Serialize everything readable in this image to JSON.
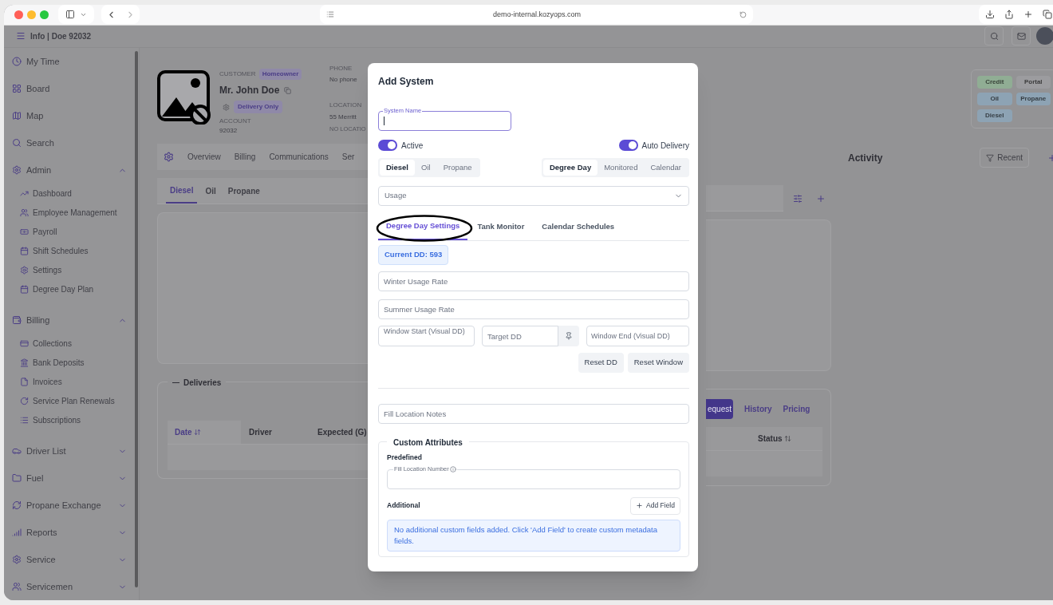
{
  "browser": {
    "url": "demo-internal.kozyops.com"
  },
  "header": {
    "title": "Info | Doe 92032"
  },
  "sidebar": {
    "items": [
      {
        "label": "My Time"
      },
      {
        "label": "Board"
      },
      {
        "label": "Map"
      },
      {
        "label": "Search"
      },
      {
        "label": "Admin",
        "expanded": true,
        "children": [
          {
            "label": "Dashboard"
          },
          {
            "label": "Employee Management"
          },
          {
            "label": "Payroll"
          },
          {
            "label": "Shift Schedules"
          },
          {
            "label": "Settings"
          },
          {
            "label": "Degree Day Plan"
          }
        ]
      },
      {
        "label": "Billing",
        "expanded": true,
        "children": [
          {
            "label": "Collections"
          },
          {
            "label": "Bank Deposits"
          },
          {
            "label": "Invoices"
          },
          {
            "label": "Service Plan Renewals"
          },
          {
            "label": "Subscriptions"
          }
        ]
      },
      {
        "label": "Driver List",
        "expanded": false
      },
      {
        "label": "Fuel",
        "expanded": false
      },
      {
        "label": "Propane Exchange",
        "expanded": false
      },
      {
        "label": "Reports",
        "expanded": false
      },
      {
        "label": "Service",
        "expanded": false
      },
      {
        "label": "Servicemen",
        "expanded": false
      }
    ]
  },
  "customer": {
    "type_label": "CUSTOMER",
    "type_badge": "Homeowner",
    "name": "Mr. John Doe",
    "delivery_badge": "Delivery Only",
    "account_label": "ACCOUNT",
    "account": "92032",
    "phone_label": "PHONE",
    "phone": "No phone",
    "location_label": "LOCATION",
    "location": "55 Merritt",
    "location_note": "NO LOCATIO"
  },
  "tags": [
    {
      "label": "Credit",
      "color": "#90ad94"
    },
    {
      "label": "Portal",
      "color": "#9c9c9f"
    },
    {
      "label": "Oil",
      "color": "#8da3b4"
    },
    {
      "label": "Propane",
      "color": "#8da3b4"
    },
    {
      "label": "Diesel",
      "color": "#8da3b4"
    }
  ],
  "tabs": [
    {
      "label": "Overview",
      "selected": false
    },
    {
      "label": "Billing",
      "selected": false
    },
    {
      "label": "Communications",
      "selected": false
    },
    {
      "label": "Ser",
      "selected": false
    }
  ],
  "fuel_tabs": [
    {
      "label": "Diesel",
      "selected": true
    },
    {
      "label": "Oil",
      "selected": false
    },
    {
      "label": "Propane",
      "selected": false
    }
  ],
  "deliveries": {
    "title": "Deliveries",
    "buttons": [
      {
        "label": "equest",
        "selected": true
      },
      {
        "label": "History",
        "selected": false
      },
      {
        "label": "Pricing",
        "selected": false
      }
    ],
    "columns": [
      "Date",
      "Driver",
      "Expected (G)",
      "Status"
    ]
  },
  "activity": {
    "title": "Activity",
    "filter": "Recent"
  },
  "modal": {
    "title": "Add System",
    "system_name_label": "System Name",
    "toggles": [
      {
        "label": "Active",
        "on": true
      },
      {
        "label": "Auto Delivery",
        "on": true
      }
    ],
    "fuel_segments": [
      {
        "label": "Diesel",
        "selected": true
      },
      {
        "label": "Oil",
        "selected": false
      },
      {
        "label": "Propane",
        "selected": false
      }
    ],
    "mode_segments": [
      {
        "label": "Degree Day",
        "selected": true
      },
      {
        "label": "Monitored",
        "selected": false
      },
      {
        "label": "Calendar",
        "selected": false
      }
    ],
    "usage_select": "Usage",
    "tabs": [
      {
        "label": "Degree Day Settings",
        "selected": true
      },
      {
        "label": "Tank Monitor",
        "selected": false
      },
      {
        "label": "Calendar Schedules",
        "selected": false
      }
    ],
    "current_dd": "Current DD: 593",
    "winter_placeholder": "Winter Usage Rate",
    "summer_placeholder": "Summer Usage Rate",
    "window_start_placeholder": "Window Start (Visual DD)",
    "target_placeholder": "Target DD",
    "window_end_placeholder": "Window End (Visual DD)",
    "buttons": [
      "Reset DD",
      "Reset Window"
    ],
    "notes_placeholder": "Fill Location Notes",
    "custom": {
      "title": "Custom Attributes",
      "predefined_label": "Predefined",
      "field_label": "Fill Location Number",
      "additional_label": "Additional",
      "add_button": "Add Field",
      "info": "No additional custom fields added. Click 'Add Field' to create custom metadata fields."
    }
  }
}
